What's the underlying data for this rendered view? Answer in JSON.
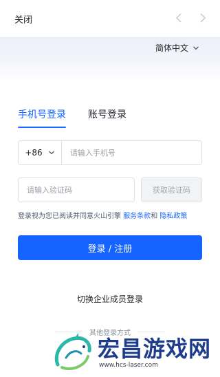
{
  "header": {
    "close_label": "关闭",
    "back_icon": "chevron-left-icon",
    "forward_icon": "chevron-right-icon"
  },
  "language": {
    "selected": "简体中文",
    "icon": "chevron-down-icon"
  },
  "tabs": [
    {
      "label": "手机号登录",
      "active": true
    },
    {
      "label": "账号登录",
      "active": false
    }
  ],
  "phone": {
    "country_code": "+86",
    "placeholder": "请输入手机号",
    "value": ""
  },
  "code": {
    "placeholder": "请输入验证码",
    "value": "",
    "get_code_label": "获取验证码"
  },
  "agreement": {
    "prefix": "登录视为您已阅读并同意火山引擎",
    "terms_link": "服务条款",
    "and": "和",
    "privacy_link": "隐私政策"
  },
  "submit_label": "登录 / 注册",
  "switch_enterprise_label": "切换企业成员登录",
  "other_methods_label": "其他登录方式",
  "watermark": {
    "title": "宏昌游戏网",
    "url": "www.hcs-laser.com"
  },
  "colors": {
    "accent": "#1664ff",
    "watermark_text": "#1e3c8c",
    "watermark_logo_teal": "#2bb8a8",
    "watermark_logo_green": "#7cc96b"
  }
}
